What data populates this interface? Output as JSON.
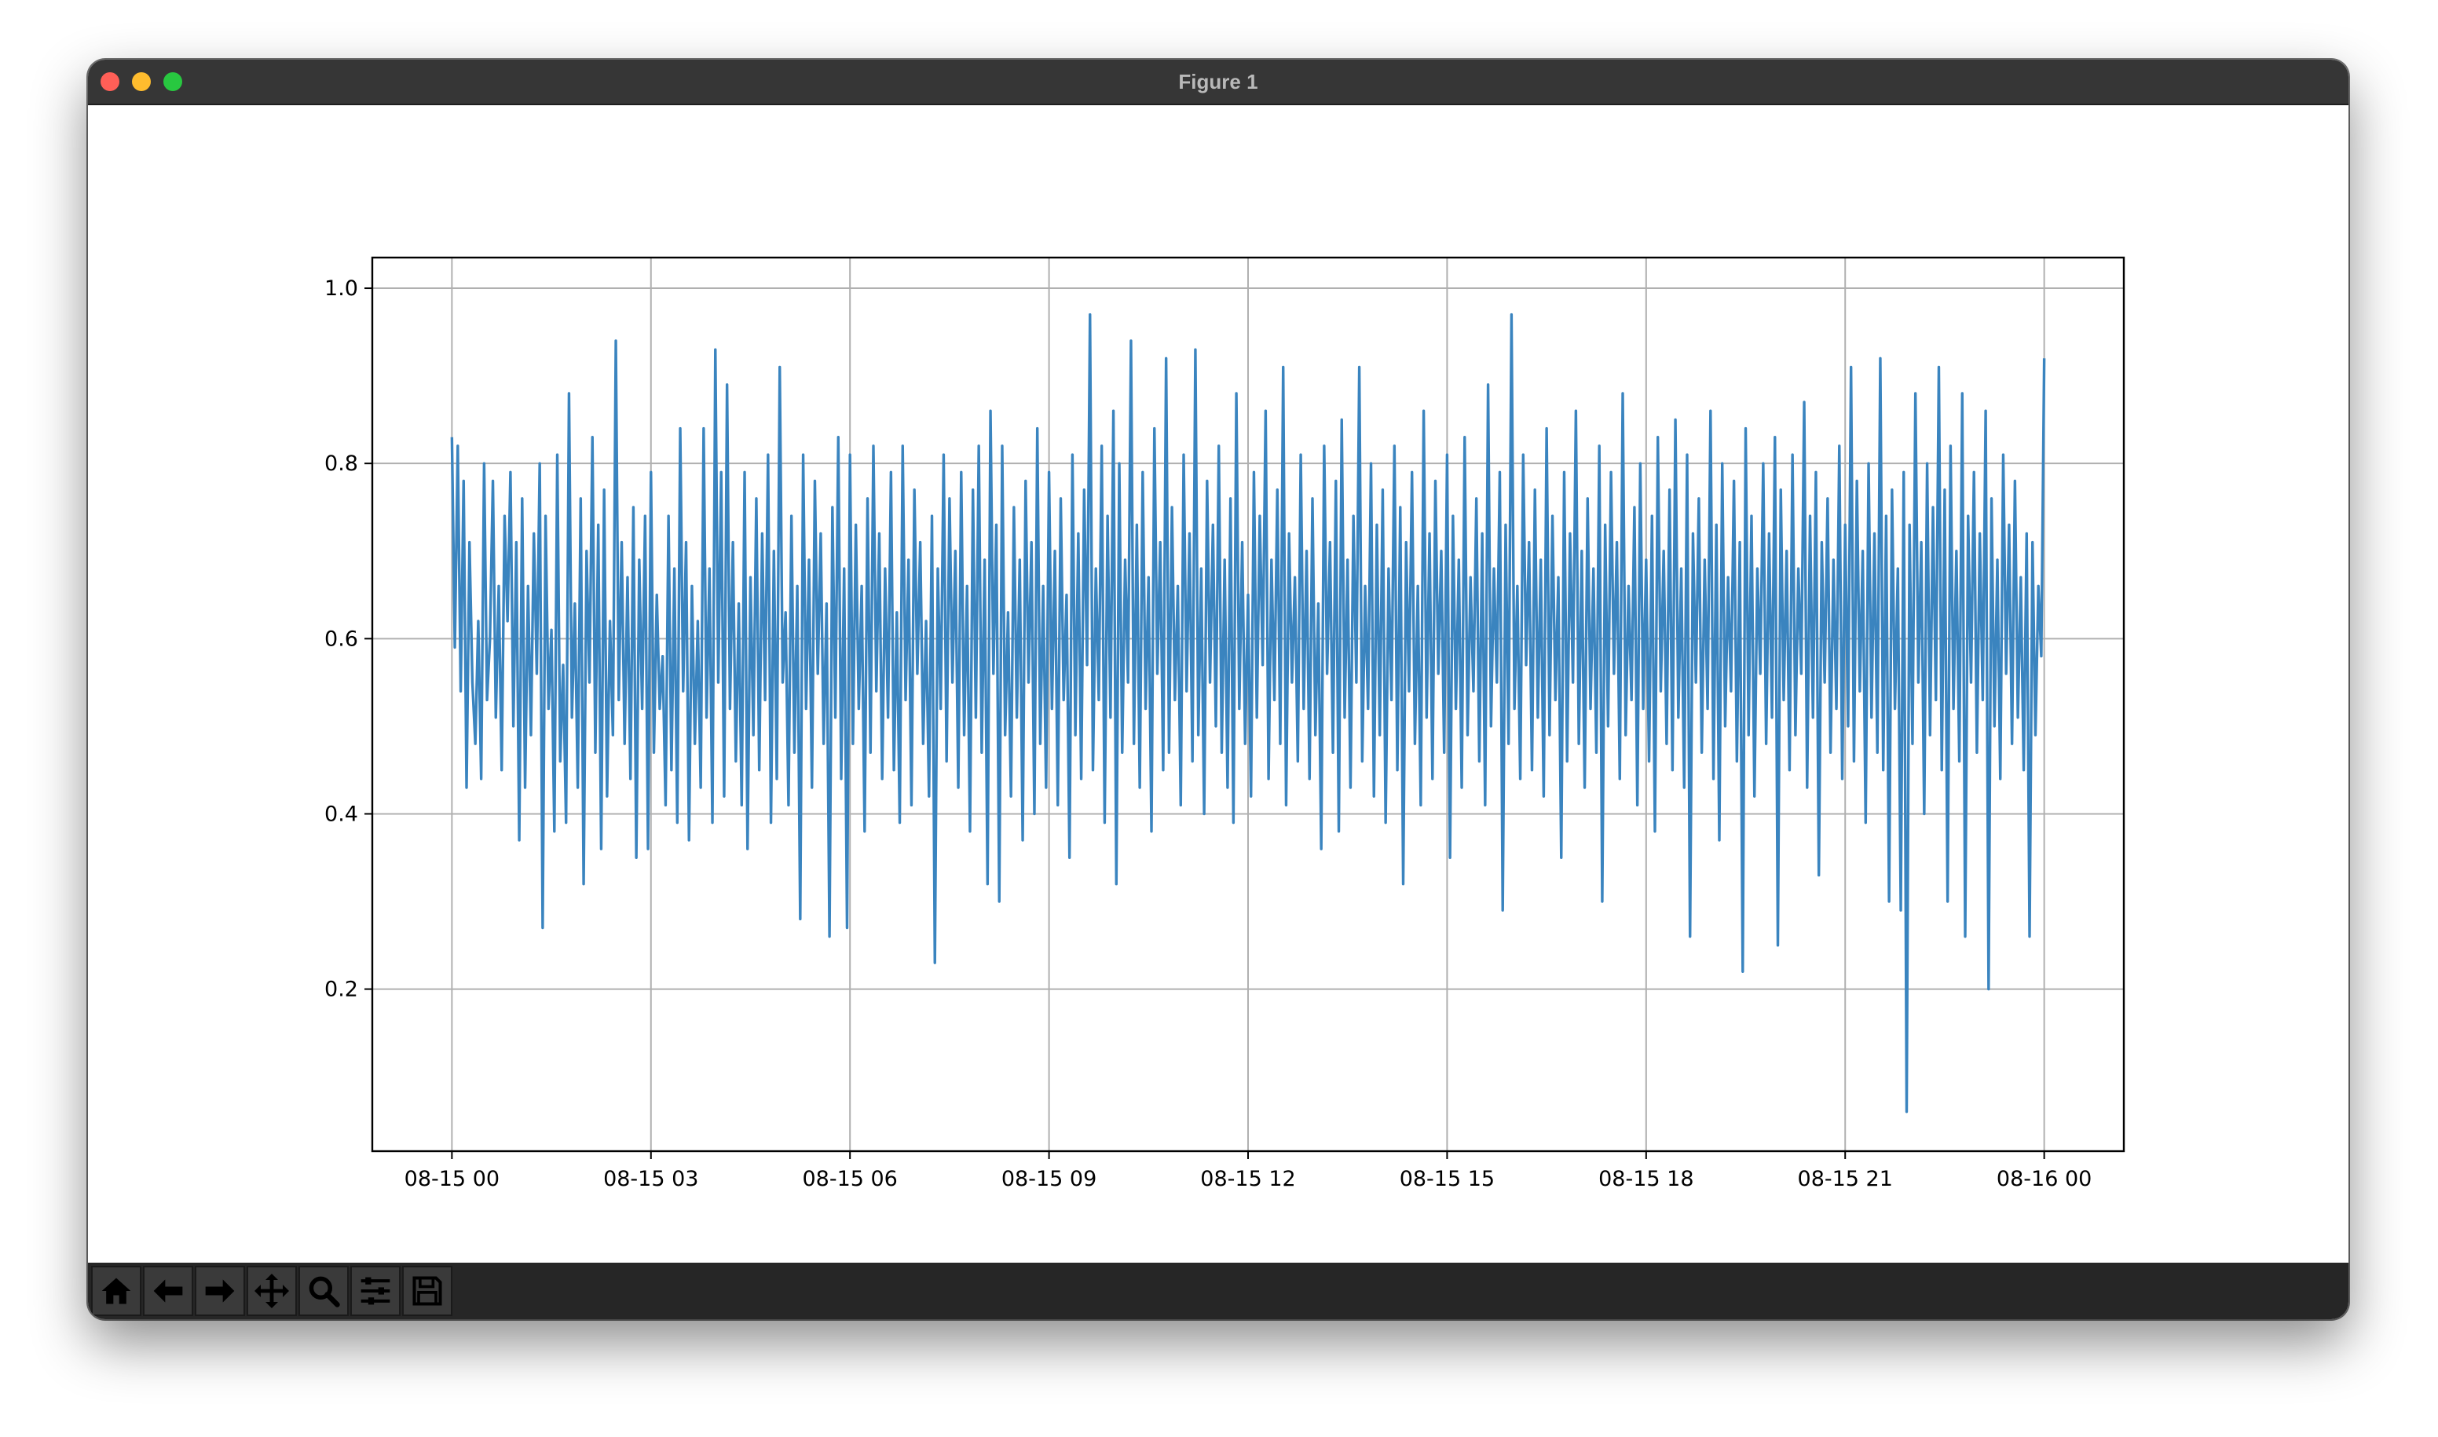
{
  "window": {
    "title": "Figure 1"
  },
  "toolbar": {
    "buttons": [
      {
        "name": "home-icon"
      },
      {
        "name": "arrow-left-icon"
      },
      {
        "name": "arrow-right-icon"
      },
      {
        "name": "move-icon"
      },
      {
        "name": "zoom-icon"
      },
      {
        "name": "sliders-icon"
      },
      {
        "name": "save-icon"
      }
    ]
  },
  "colors": {
    "line": "#3a84bf",
    "grid": "#b0b0b0",
    "titlebar": "#363636",
    "toolbar": "#262626"
  },
  "chart_data": {
    "type": "line",
    "xlabel": "",
    "ylabel": "",
    "grid": true,
    "legend": "none",
    "x_start": "2023-08-15 00:00",
    "x_end": "2023-08-16 00:00",
    "x_step_minutes": 1,
    "xlim": [
      "2023-08-14 22:48",
      "2023-08-16 01:12"
    ],
    "ylim": [
      0.015,
      1.035
    ],
    "xticks": [
      "08-15 00",
      "08-15 03",
      "08-15 06",
      "08-15 09",
      "08-15 12",
      "08-15 15",
      "08-15 18",
      "08-15 21",
      "08-16 00"
    ],
    "yticks": [
      0.2,
      0.4,
      0.6,
      0.8,
      1.0
    ],
    "ytick_labels": [
      "0.2",
      "0.4",
      "0.6",
      "0.8",
      "1.0"
    ],
    "series": [
      {
        "values": [
          0.83,
          0.59,
          0.82,
          0.54,
          0.78,
          0.43,
          0.71,
          0.55,
          0.48,
          0.62,
          0.44,
          0.8,
          0.53,
          0.6,
          0.78,
          0.51,
          0.66,
          0.45,
          0.74,
          0.62,
          0.79,
          0.5,
          0.71,
          0.37,
          0.76,
          0.43,
          0.66,
          0.49,
          0.72,
          0.56,
          0.8,
          0.27,
          0.74,
          0.52,
          0.61,
          0.38,
          0.81,
          0.46,
          0.57,
          0.39,
          0.88,
          0.51,
          0.64,
          0.43,
          0.76,
          0.32,
          0.7,
          0.55,
          0.83,
          0.47,
          0.73,
          0.36,
          0.77,
          0.42,
          0.62,
          0.49,
          0.94,
          0.53,
          0.71,
          0.48,
          0.67,
          0.44,
          0.75,
          0.35,
          0.69,
          0.52,
          0.74,
          0.36,
          0.79,
          0.47,
          0.65,
          0.52,
          0.58,
          0.41,
          0.74,
          0.45,
          0.68,
          0.39,
          0.84,
          0.54,
          0.71,
          0.37,
          0.66,
          0.48,
          0.62,
          0.43,
          0.84,
          0.51,
          0.68,
          0.39,
          0.93,
          0.55,
          0.79,
          0.42,
          0.89,
          0.52,
          0.71,
          0.46,
          0.64,
          0.41,
          0.79,
          0.36,
          0.67,
          0.49,
          0.76,
          0.45,
          0.72,
          0.53,
          0.81,
          0.39,
          0.7,
          0.44,
          0.91,
          0.55,
          0.63,
          0.41,
          0.74,
          0.47,
          0.66,
          0.28,
          0.81,
          0.52,
          0.69,
          0.43,
          0.78,
          0.56,
          0.72,
          0.48,
          0.64,
          0.26,
          0.75,
          0.51,
          0.83,
          0.44,
          0.68,
          0.27,
          0.81,
          0.48,
          0.73,
          0.52,
          0.66,
          0.38,
          0.76,
          0.47,
          0.82,
          0.54,
          0.72,
          0.44,
          0.68,
          0.51,
          0.79,
          0.45,
          0.63,
          0.39,
          0.82,
          0.53,
          0.69,
          0.41,
          0.77,
          0.56,
          0.71,
          0.48,
          0.62,
          0.42,
          0.74,
          0.23,
          0.68,
          0.52,
          0.81,
          0.46,
          0.76,
          0.55,
          0.7,
          0.43,
          0.79,
          0.49,
          0.66,
          0.38,
          0.77,
          0.51,
          0.82,
          0.47,
          0.69,
          0.32,
          0.86,
          0.56,
          0.73,
          0.3,
          0.82,
          0.49,
          0.63,
          0.42,
          0.75,
          0.51,
          0.69,
          0.37,
          0.78,
          0.55,
          0.71,
          0.4,
          0.84,
          0.48,
          0.66,
          0.43,
          0.79,
          0.52,
          0.7,
          0.41,
          0.76,
          0.53,
          0.65,
          0.35,
          0.81,
          0.49,
          0.72,
          0.44,
          0.77,
          0.57,
          0.97,
          0.45,
          0.68,
          0.53,
          0.82,
          0.39,
          0.74,
          0.51,
          0.86,
          0.32,
          0.8,
          0.47,
          0.69,
          0.55,
          0.94,
          0.48,
          0.73,
          0.43,
          0.79,
          0.52,
          0.67,
          0.38,
          0.84,
          0.56,
          0.71,
          0.45,
          0.92,
          0.47,
          0.75,
          0.53,
          0.66,
          0.41,
          0.81,
          0.54,
          0.72,
          0.46,
          0.93,
          0.49,
          0.68,
          0.4,
          0.78,
          0.55,
          0.73,
          0.5,
          0.82,
          0.47,
          0.69,
          0.43,
          0.76,
          0.39,
          0.88,
          0.52,
          0.71,
          0.48,
          0.65,
          0.42,
          0.79,
          0.51,
          0.74,
          0.57,
          0.86,
          0.44,
          0.69,
          0.53,
          0.77,
          0.48,
          0.91,
          0.41,
          0.72,
          0.55,
          0.67,
          0.46,
          0.81,
          0.52,
          0.7,
          0.44,
          0.76,
          0.49,
          0.64,
          0.36,
          0.82,
          0.56,
          0.71,
          0.47,
          0.78,
          0.38,
          0.85,
          0.51,
          0.69,
          0.43,
          0.74,
          0.55,
          0.91,
          0.46,
          0.66,
          0.52,
          0.8,
          0.42,
          0.73,
          0.49,
          0.77,
          0.39,
          0.68,
          0.53,
          0.82,
          0.45,
          0.75,
          0.32,
          0.71,
          0.54,
          0.79,
          0.48,
          0.66,
          0.41,
          0.86,
          0.51,
          0.72,
          0.44,
          0.78,
          0.56,
          0.7,
          0.47,
          0.81,
          0.35,
          0.74,
          0.52,
          0.69,
          0.43,
          0.83,
          0.49,
          0.67,
          0.54,
          0.76,
          0.46,
          0.72,
          0.41,
          0.89,
          0.5,
          0.68,
          0.55,
          0.79,
          0.29,
          0.73,
          0.48,
          0.97,
          0.52,
          0.66,
          0.44,
          0.81,
          0.57,
          0.71,
          0.45,
          0.77,
          0.51,
          0.69,
          0.42,
          0.84,
          0.49,
          0.74,
          0.53,
          0.67,
          0.35,
          0.79,
          0.46,
          0.72,
          0.55,
          0.86,
          0.48,
          0.7,
          0.43,
          0.76,
          0.52,
          0.68,
          0.47,
          0.82,
          0.3,
          0.73,
          0.5,
          0.79,
          0.56,
          0.71,
          0.44,
          0.88,
          0.49,
          0.66,
          0.53,
          0.75,
          0.41,
          0.8,
          0.52,
          0.69,
          0.46,
          0.74,
          0.38,
          0.83,
          0.54,
          0.7,
          0.48,
          0.77,
          0.45,
          0.85,
          0.51,
          0.68,
          0.43,
          0.81,
          0.26,
          0.72,
          0.55,
          0.76,
          0.47,
          0.69,
          0.52,
          0.86,
          0.44,
          0.73,
          0.37,
          0.8,
          0.5,
          0.67,
          0.54,
          0.78,
          0.46,
          0.71,
          0.22,
          0.84,
          0.49,
          0.74,
          0.42,
          0.68,
          0.56,
          0.8,
          0.48,
          0.72,
          0.51,
          0.83,
          0.25,
          0.77,
          0.53,
          0.7,
          0.45,
          0.81,
          0.49,
          0.68,
          0.56,
          0.87,
          0.43,
          0.74,
          0.51,
          0.79,
          0.33,
          0.71,
          0.55,
          0.76,
          0.47,
          0.69,
          0.52,
          0.82,
          0.44,
          0.73,
          0.5,
          0.91,
          0.46,
          0.78,
          0.54,
          0.7,
          0.39,
          0.8,
          0.51,
          0.72,
          0.47,
          0.92,
          0.45,
          0.74,
          0.3,
          0.77,
          0.52,
          0.68,
          0.29,
          0.79,
          0.06,
          0.73,
          0.48,
          0.88,
          0.55,
          0.71,
          0.4,
          0.8,
          0.49,
          0.75,
          0.53,
          0.91,
          0.45,
          0.77,
          0.3,
          0.82,
          0.52,
          0.7,
          0.46,
          0.88,
          0.26,
          0.74,
          0.55,
          0.79,
          0.47,
          0.72,
          0.53,
          0.86,
          0.2,
          0.76,
          0.5,
          0.69,
          0.44,
          0.81,
          0.56,
          0.73,
          0.48,
          0.78,
          0.51,
          0.67,
          0.45,
          0.72,
          0.26,
          0.71,
          0.49,
          0.66,
          0.58,
          0.92
        ]
      }
    ]
  }
}
